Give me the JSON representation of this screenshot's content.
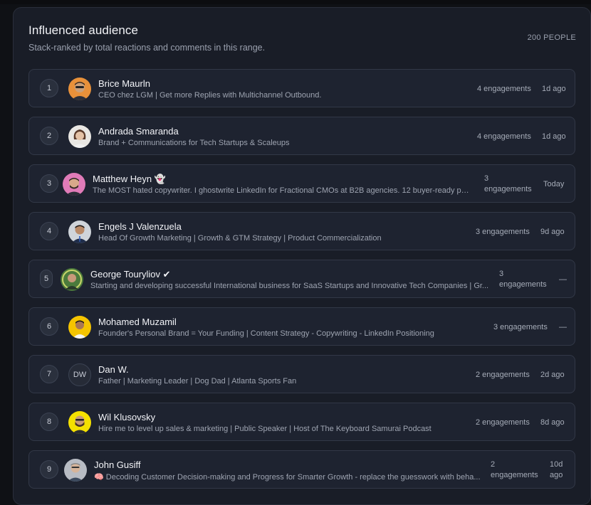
{
  "panel": {
    "title": "Influenced audience",
    "subtitle": "Stack-ranked by total reactions and comments in this range.",
    "count": "200 PEOPLE"
  },
  "rows": [
    {
      "rank": "1",
      "name": "Brice Maurln",
      "bio": "CEO chez LGM | Get more Replies with Multichannel Outbound.",
      "engagements": "4 engagements",
      "ago": "1d ago"
    },
    {
      "rank": "2",
      "name": "Andrada Smaranda",
      "bio": "Brand + Communications for Tech Startups & Scaleups",
      "engagements": "4 engagements",
      "ago": "1d ago"
    },
    {
      "rank": "3",
      "name": "Matthew Heyn 👻",
      "bio": "The MOST hated copywriter. I ghostwrite LinkedIn for Fractional CMOs at B2B agencies. 12 buyer-ready post...",
      "engagements_1": "3",
      "engagements_2": "engagements",
      "ago": "Today"
    },
    {
      "rank": "4",
      "name": "Engels J Valenzuela",
      "bio": "Head Of Growth Marketing | Growth & GTM Strategy | Product Commercialization",
      "engagements": "3 engagements",
      "ago": "9d ago"
    },
    {
      "rank": "5",
      "name": "George Touryliov ✔",
      "bio": "Starting and developing successful International business for SaaS Startups and Innovative Tech Companies | Gr...",
      "engagements_1": "3",
      "engagements_2": "engagements",
      "ago": "—"
    },
    {
      "rank": "6",
      "name": "Mohamed Muzamil",
      "bio": "Founder's Personal Brand = Your Funding | Content Strategy - Copywriting - LinkedIn Positioning",
      "engagements": "3 engagements",
      "ago": "—"
    },
    {
      "rank": "7",
      "name": "Dan W.",
      "initials": "DW",
      "bio": "Father | Marketing Leader | Dog Dad | Atlanta Sports Fan",
      "engagements": "2 engagements",
      "ago": "2d ago"
    },
    {
      "rank": "8",
      "name": "Wil Klusovsky",
      "bio": "Hire me to level up sales & marketing | Public Speaker | Host of The Keyboard Samurai Podcast",
      "engagements": "2 engagements",
      "ago": "8d ago"
    },
    {
      "rank": "9",
      "name": "John Gusiff",
      "bio": "🧠 Decoding Customer Decision-making and Progress for Smarter Growth - replace the guesswork with beha...",
      "engagements_1": "2",
      "engagements_2": "engagements",
      "ago_1": "10d",
      "ago_2": "ago"
    }
  ]
}
